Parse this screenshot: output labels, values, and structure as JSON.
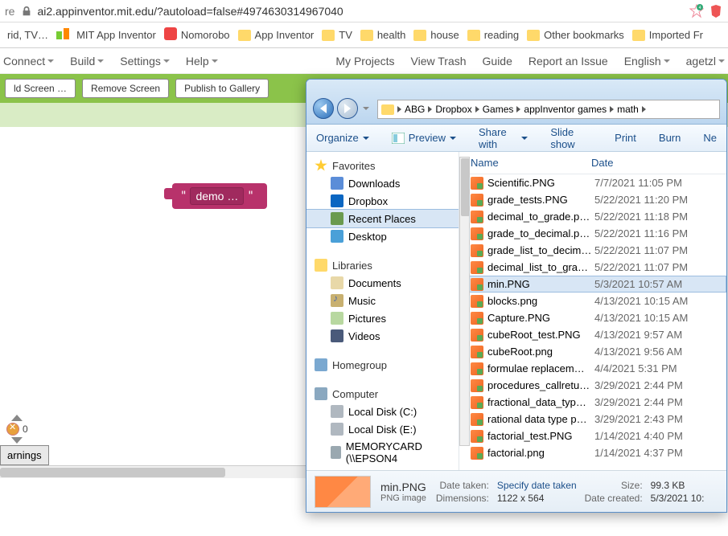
{
  "url_bar": {
    "prefix": "re",
    "url": "ai2.appinventor.mit.edu/?autoload=false#4974630314967040"
  },
  "bookmarks": [
    {
      "label": "rid, TV…",
      "type": "tab"
    },
    {
      "label": "MIT App Inventor",
      "type": "mit"
    },
    {
      "label": "Nomorobo",
      "type": "nomo"
    },
    {
      "label": "App Inventor",
      "type": "folder"
    },
    {
      "label": "TV",
      "type": "folder"
    },
    {
      "label": "health",
      "type": "folder"
    },
    {
      "label": "house",
      "type": "folder"
    },
    {
      "label": "reading",
      "type": "folder"
    },
    {
      "label": "Other bookmarks",
      "type": "folder"
    },
    {
      "label": "Imported Fr",
      "type": "folder"
    }
  ],
  "app_menu": {
    "left": [
      "Connect",
      "Build",
      "Settings",
      "Help"
    ],
    "right": [
      "My Projects",
      "View Trash",
      "Guide",
      "Report an Issue",
      "English",
      "agetzl"
    ]
  },
  "green_bar": {
    "buttons": [
      "ld Screen …",
      "Remove Screen",
      "Publish to Gallery"
    ]
  },
  "canvas": {
    "block_text": "demo …",
    "status_count": "0",
    "warnings": "arnings"
  },
  "explorer": {
    "breadcrumb": [
      "ABG",
      "Dropbox",
      "Games",
      "appInventor games",
      "math"
    ],
    "toolbar": {
      "organize": "Organize",
      "preview": "Preview",
      "share": "Share with",
      "slideshow": "Slide show",
      "print": "Print",
      "burn": "Burn",
      "new": "Ne"
    },
    "nav_pane": {
      "favorites": {
        "label": "Favorites",
        "items": [
          "Downloads",
          "Dropbox",
          "Recent Places",
          "Desktop"
        ]
      },
      "libraries": {
        "label": "Libraries",
        "items": [
          "Documents",
          "Music",
          "Pictures",
          "Videos"
        ]
      },
      "homegroup": {
        "label": "Homegroup"
      },
      "computer": {
        "label": "Computer",
        "items": [
          "Local Disk (C:)",
          "Local Disk (E:)",
          "MEMORYCARD (\\\\EPSON4"
        ]
      }
    },
    "columns": {
      "name": "Name",
      "date": "Date"
    },
    "files": [
      {
        "name": "Scientific.PNG",
        "date": "7/7/2021 11:05 PM"
      },
      {
        "name": "grade_tests.PNG",
        "date": "5/22/2021 11:20 PM"
      },
      {
        "name": "decimal_to_grade.p…",
        "date": "5/22/2021 11:18 PM"
      },
      {
        "name": "grade_to_decimal.p…",
        "date": "5/22/2021 11:16 PM"
      },
      {
        "name": "grade_list_to_decim…",
        "date": "5/22/2021 11:07 PM"
      },
      {
        "name": "decimal_list_to_gra…",
        "date": "5/22/2021 11:07 PM"
      },
      {
        "name": "min.PNG",
        "date": "5/3/2021 10:57 AM",
        "selected": true
      },
      {
        "name": "blocks.png",
        "date": "4/13/2021 10:15 AM"
      },
      {
        "name": "Capture.PNG",
        "date": "4/13/2021 10:15 AM"
      },
      {
        "name": "cubeRoot_test.PNG",
        "date": "4/13/2021 9:57 AM"
      },
      {
        "name": "cubeRoot.png",
        "date": "4/13/2021 9:56 AM"
      },
      {
        "name": "formulae replacem…",
        "date": "4/4/2021 5:31 PM"
      },
      {
        "name": "procedures_callretu…",
        "date": "3/29/2021 2:44 PM"
      },
      {
        "name": "fractional_data_typ…",
        "date": "3/29/2021 2:44 PM"
      },
      {
        "name": "rational data type p…",
        "date": "3/29/2021 2:43 PM"
      },
      {
        "name": "factorial_test.PNG",
        "date": "1/14/2021 4:40 PM"
      },
      {
        "name": "factorial.png",
        "date": "1/14/2021 4:37 PM"
      }
    ],
    "details": {
      "name": "min.PNG",
      "type": "PNG image",
      "date_taken_k": "Date taken:",
      "date_taken_v": "Specify date taken",
      "dimensions_k": "Dimensions:",
      "dimensions_v": "1122 x 564",
      "size_k": "Size:",
      "size_v": "99.3 KB",
      "created_k": "Date created:",
      "created_v": "5/3/2021 10:"
    }
  }
}
